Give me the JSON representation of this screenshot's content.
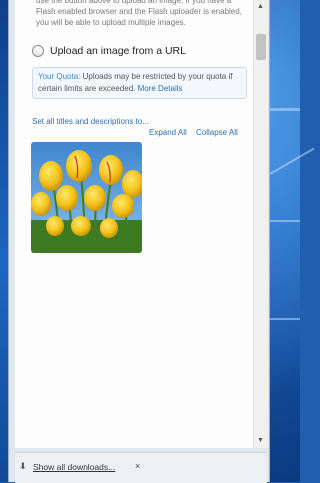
{
  "page": {
    "help_text": "use the button above to upload an image. If you have a Flash enabled browser and the Flash uploader is enabled, you will be able to upload multiple images.",
    "upload_url_option": "Upload an image from a URL",
    "quota": {
      "label": "Your Quota:",
      "message": " Uploads may be restricted by your quota if certain limits are exceeded. ",
      "link": "More Details"
    },
    "set_all_link": "Set all titles and descriptions to...",
    "expand_all": "Expand All",
    "collapse_all": "Collapse All",
    "thumbnail_subject": "yellow tulips"
  },
  "downloads_bar": {
    "show_all": "Show all downloads...",
    "close": "×"
  },
  "colors": {
    "link": "#2f6fb0",
    "quota_bg": "#f3f8fd",
    "desktop": "#1d66c4"
  },
  "icons": [
    "download-arrow-icon",
    "close-icon",
    "scroll-up-icon",
    "scroll-down-icon"
  ]
}
